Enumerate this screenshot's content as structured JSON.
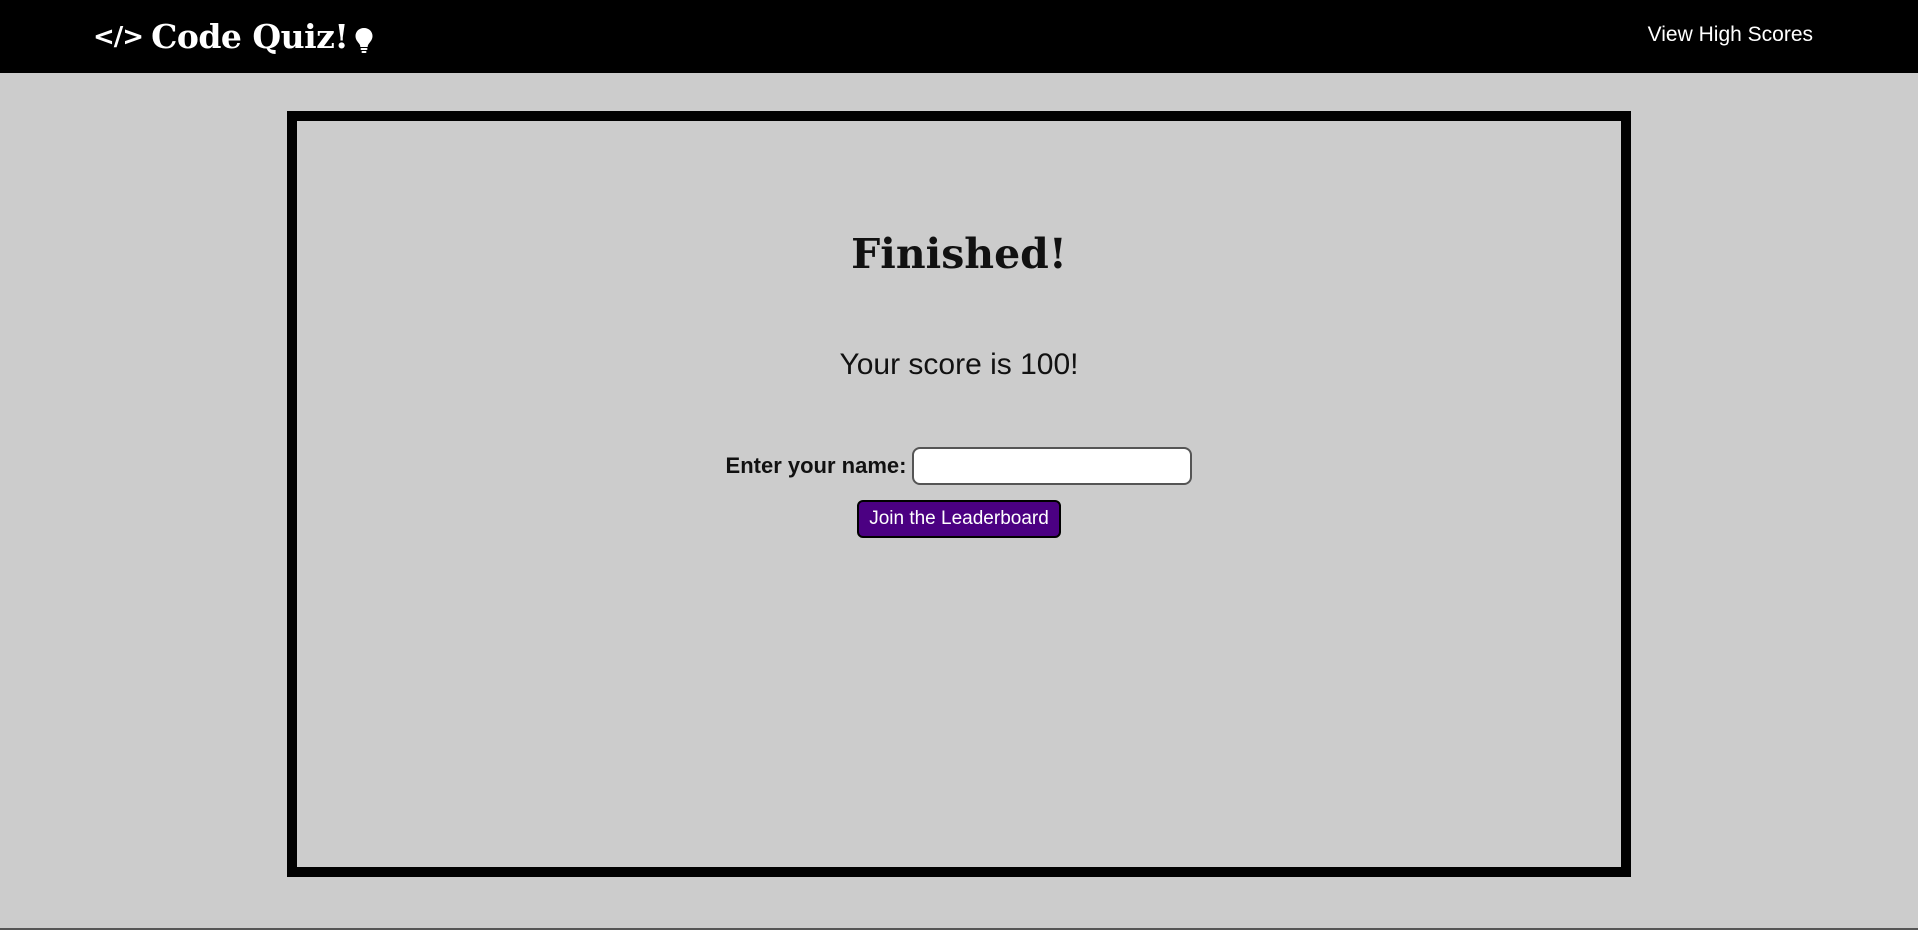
{
  "navbar": {
    "brand_text": "Code Quiz!",
    "code_icon": "</>",
    "high_scores_link": "View High Scores"
  },
  "result": {
    "title": "Finished!",
    "score_text": "Your score is 100!"
  },
  "form": {
    "name_label": "Enter your name:",
    "name_value": "",
    "submit_label": "Join the Leaderboard"
  },
  "colors": {
    "navbar_bg": "#000000",
    "page_bg": "#cccccc",
    "button_bg": "#4b0082",
    "button_text": "#ffffff"
  },
  "icons": [
    "code-icon",
    "lightbulb-icon"
  ]
}
